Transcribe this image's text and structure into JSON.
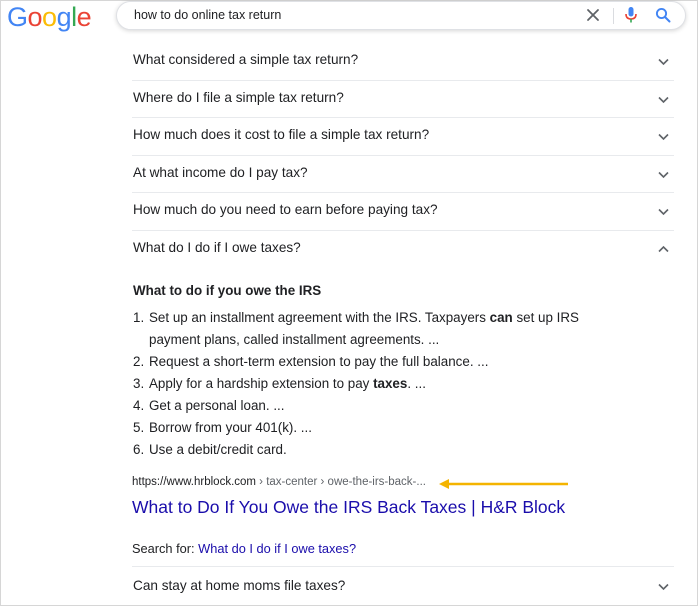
{
  "header": {
    "logo": [
      "G",
      "o",
      "o",
      "g",
      "l",
      "e"
    ],
    "logo_colors": [
      "#4285F4",
      "#EA4335",
      "#FBBC05",
      "#4285F4",
      "#34A853",
      "#EA4335"
    ],
    "query": "how to do online tax return"
  },
  "questions": [
    {
      "text": "What considered a simple tax return?",
      "state": "collapsed"
    },
    {
      "text": "Where do I file a simple tax return?",
      "state": "collapsed"
    },
    {
      "text": "How much does it cost to file a simple tax return?",
      "state": "collapsed"
    },
    {
      "text": "At what income do I pay tax?",
      "state": "collapsed"
    },
    {
      "text": "How much do you need to earn before paying tax?",
      "state": "collapsed"
    },
    {
      "text": "What do I do if I owe taxes?",
      "state": "expanded"
    }
  ],
  "answer": {
    "heading": "What to do if you owe the IRS",
    "items": [
      {
        "num": "1.",
        "pre": "Set up an installment agreement with the IRS. Taxpayers ",
        "bold": "can",
        "post": " set up IRS payment plans, called installment agreements. ..."
      },
      {
        "num": "2.",
        "pre": "Request a short-term extension to pay the full balance. ...",
        "bold": "",
        "post": ""
      },
      {
        "num": "3.",
        "pre": "Apply for a hardship extension to pay ",
        "bold": "taxes",
        "post": ". ..."
      },
      {
        "num": "4.",
        "pre": "Get a personal loan. ...",
        "bold": "",
        "post": ""
      },
      {
        "num": "5.",
        "pre": "Borrow from your 401(k). ...",
        "bold": "",
        "post": ""
      },
      {
        "num": "6.",
        "pre": "Use a debit/credit card.",
        "bold": "",
        "post": ""
      }
    ],
    "cite_domain": "https://www.hrblock.com",
    "cite_path": " › tax-center › owe-the-irs-back-...",
    "result_title": "What to Do If You Owe the IRS Back Taxes | H&R Block",
    "search_for_label": "Search for: ",
    "search_for_link": "What do I do if I owe taxes?"
  },
  "last_question": {
    "text": "Can stay at home moms file taxes?",
    "state": "collapsed"
  },
  "colors": {
    "link": "#1a0dab",
    "arrow": "#f4b400",
    "text": "#202124",
    "muted": "#5f6368"
  }
}
